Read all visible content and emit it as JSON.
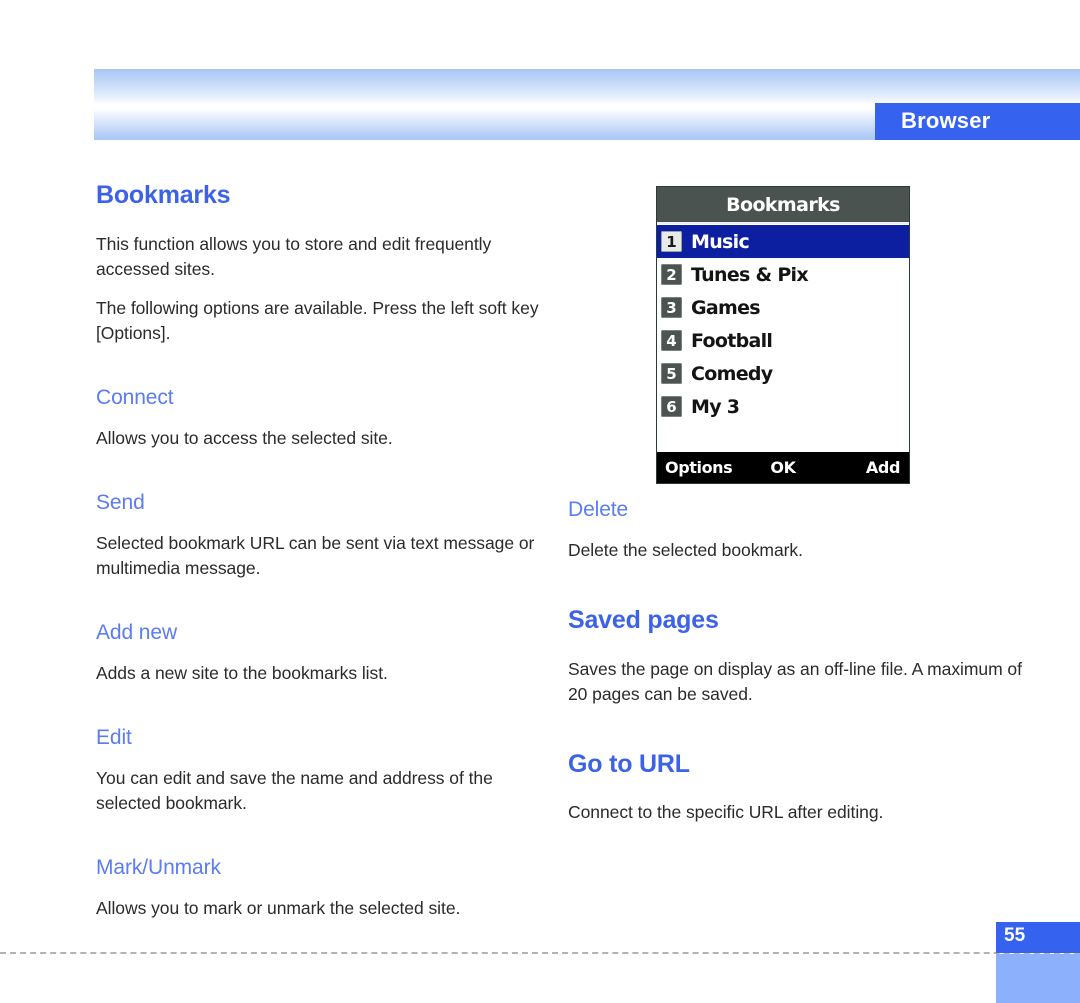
{
  "header": {
    "tab_label": "Browser"
  },
  "left_column": {
    "section_title": "Bookmarks",
    "intro_1": "This function allows you to store and edit frequently accessed sites.",
    "intro_2": "The following options are available. Press the left soft key [Options].",
    "options": [
      {
        "name": "Connect",
        "desc": "Allows you to access the selected site."
      },
      {
        "name": "Send",
        "desc": "Selected bookmark URL can be sent via text message or multimedia message."
      },
      {
        "name": "Add new",
        "desc": "Adds a new site to the bookmarks list."
      },
      {
        "name": "Edit",
        "desc": "You can edit and save the name and address of the selected bookmark."
      },
      {
        "name": "Mark/Unmark",
        "desc": "Allows you to mark or unmark the selected site."
      }
    ]
  },
  "right_column": {
    "delete_title": "Delete",
    "delete_desc": "Delete the selected bookmark.",
    "saved_pages_title": "Saved pages",
    "saved_pages_desc": "Saves the page on display as an off-line file. A maximum of 20 pages can be saved.",
    "go_to_url_title": "Go to URL",
    "go_to_url_desc": "Connect to the specific URL after editing."
  },
  "phone_screen": {
    "title": "Bookmarks",
    "items": [
      {
        "num": "1",
        "label": "Music",
        "selected": true
      },
      {
        "num": "2",
        "label": "Tunes & Pix",
        "selected": false
      },
      {
        "num": "3",
        "label": "Games",
        "selected": false
      },
      {
        "num": "4",
        "label": "Football",
        "selected": false
      },
      {
        "num": "5",
        "label": "Comedy",
        "selected": false
      },
      {
        "num": "6",
        "label": "My 3",
        "selected": false
      }
    ],
    "softkeys": {
      "left": "Options",
      "middle": "OK",
      "right": "Add"
    }
  },
  "footer": {
    "page_number": "55"
  },
  "colors": {
    "accent_blue": "#3563f0",
    "heading_blue": "#3b62e8",
    "subheading_blue": "#5b7cf2",
    "page_block_light": "#8cb0fb",
    "phone_title_bar": "#4a5350",
    "phone_selected_row": "#0b1fa0"
  }
}
